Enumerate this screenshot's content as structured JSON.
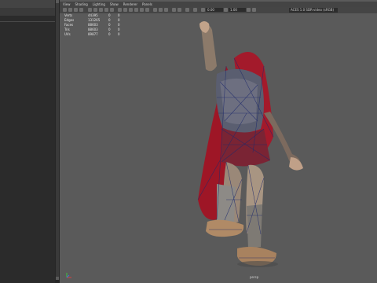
{
  "menu": [
    "View",
    "Shading",
    "Lighting",
    "Show",
    "Renderer",
    "Panels"
  ],
  "toolbar": {
    "field_a": "0.00",
    "field_b": "1.00",
    "camera_select": "ACES 1.0 SDR-video (sRGB)"
  },
  "hud": {
    "rows": [
      {
        "label": "Verts",
        "v1": "44395",
        "v2": "0",
        "v3": "0"
      },
      {
        "label": "Edges",
        "v1": "131265",
        "v2": "0",
        "v3": "0"
      },
      {
        "label": "Faces",
        "v1": "88603",
        "v2": "0",
        "v3": "0"
      },
      {
        "label": "Tris",
        "v1": "88603",
        "v2": "0",
        "v3": "0"
      },
      {
        "label": "UVs",
        "v1": "89877",
        "v2": "0",
        "v3": "0"
      }
    ]
  },
  "camera_label": "persp",
  "colors": {
    "viewport_bg": "#5a5a5a",
    "armor_red": "#b11a2a",
    "wire": "#1f2a6b"
  }
}
